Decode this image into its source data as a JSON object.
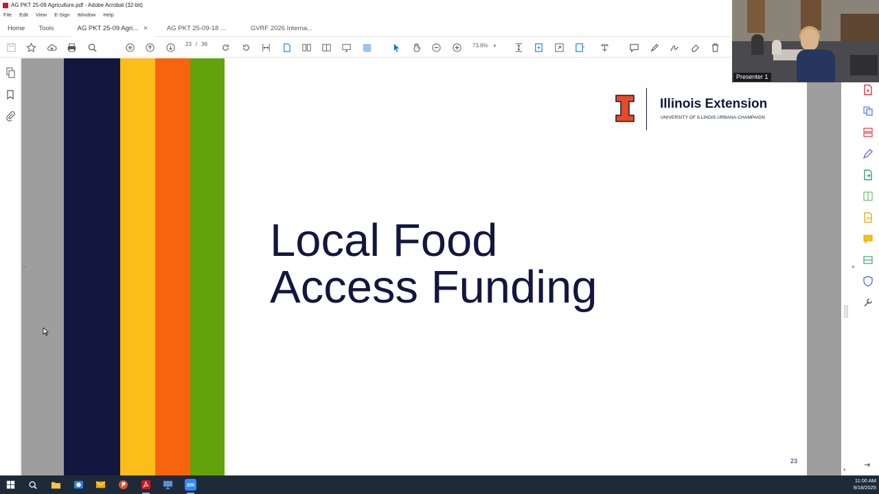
{
  "window": {
    "title": "AG PKT 25-09 Agriculture.pdf - Adobe Acrobat (32-bit)",
    "menu": [
      "File",
      "Edit",
      "View",
      "E-Sign",
      "Window",
      "Help"
    ]
  },
  "tabs": {
    "home": "Home",
    "tools": "Tools",
    "documents": [
      {
        "label": "AG PKT 25-09 Agri...",
        "active": true,
        "close": "×"
      },
      {
        "label": "AG PKT 25-09-18 ...",
        "active": false
      },
      {
        "label": "GVRF 2026 Interna...",
        "active": false
      }
    ]
  },
  "toolbar": {
    "current_page": "23",
    "page_separator": "/",
    "total_pages": "36",
    "zoom": "73.8%",
    "zoom_caret": "▾",
    "accent_color": "#1473e6"
  },
  "slide": {
    "title_line1": "Local Food",
    "title_line2": "Access Funding",
    "logo_name": "Illinois Extension",
    "logo_subtitle": "UNIVERSITY OF ILLINOIS URBANA-CHAMPAIGN",
    "page_number": "23",
    "stripe_colors": [
      "#13173f",
      "#fbbd19",
      "#f7640e",
      "#62a20a"
    ],
    "logo_color": "#e84a27",
    "title_color": "#13173f"
  },
  "video": {
    "label": "Presenter 1"
  },
  "taskbar": {
    "time": "11:00 AM",
    "date": "9/18/2025",
    "zoom_app_label": "zm"
  }
}
